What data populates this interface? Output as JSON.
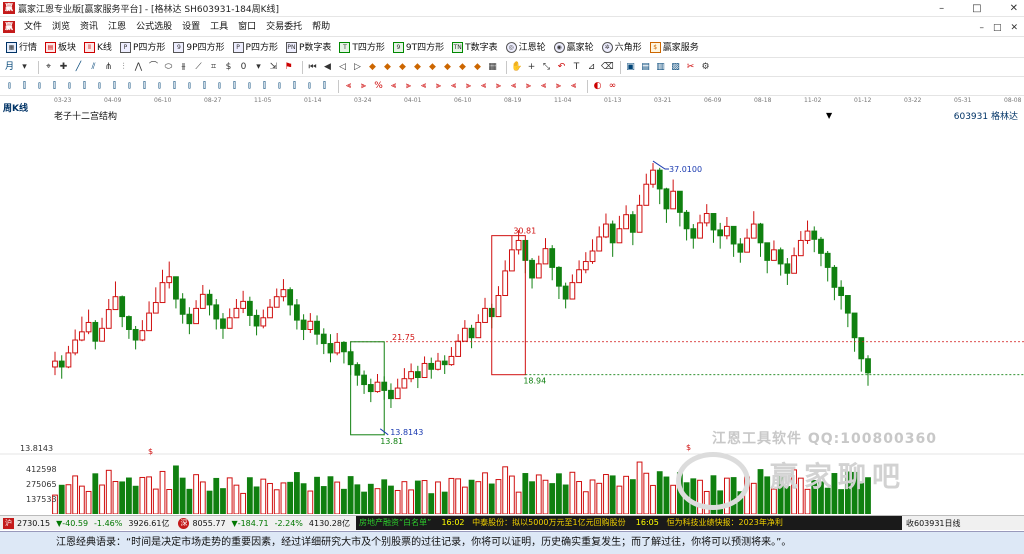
{
  "window": {
    "title": "赢家江恩专业版[赢家服务平台] - [格林达  SH603931-184周K线]",
    "minimize": "–",
    "restore": "□",
    "close": "✕"
  },
  "menu": {
    "items": [
      "文件",
      "浏览",
      "资讯",
      "江恩",
      "公式选股",
      "设置",
      "工具",
      "窗口",
      "交易委托",
      "帮助"
    ],
    "mdi": [
      "–",
      "□",
      "✕"
    ]
  },
  "toolbar1": {
    "items": [
      {
        "label": "行情",
        "icon": "grid-icon"
      },
      {
        "label": "板块",
        "icon": "blocks-icon"
      },
      {
        "label": "K线",
        "icon": "kline-icon"
      },
      {
        "label": "P四方形",
        "icon": "p-square-icon"
      },
      {
        "label": "9P四方形",
        "icon": "9p-square-icon"
      },
      {
        "label": "P四方形",
        "icon": "p-square-icon"
      },
      {
        "label": "P数字表",
        "icon": "p-table-icon"
      },
      {
        "label": "T四方形",
        "icon": "t-square-icon"
      },
      {
        "label": "9T四方形",
        "icon": "9t-square-icon"
      },
      {
        "label": "T数字表",
        "icon": "t-table-icon"
      },
      {
        "label": "江恩轮",
        "icon": "gann-wheel-icon"
      },
      {
        "label": "赢家轮",
        "icon": "winner-wheel-icon"
      },
      {
        "label": "六角形",
        "icon": "hexagon-icon"
      },
      {
        "label": "赢家服务",
        "icon": "dollar-icon"
      }
    ]
  },
  "toolbar2": {
    "period_select": "月"
  },
  "chart_header": {
    "period": "周K线",
    "study_name": "老子十二宫结构",
    "stock_code": "603931",
    "stock_name": "格林达",
    "dropdown": "▼"
  },
  "date_ticks": [
    "03-23",
    "04-09",
    "06-10",
    "08-27",
    "11-05",
    "01-14",
    "03-24",
    "04-01",
    "06-10",
    "08-19",
    "11-04",
    "01-13",
    "03-21",
    "06-09",
    "08-18",
    "11-02",
    "01-12",
    "03-22",
    "05-31",
    "08-08"
  ],
  "chart_data": {
    "type": "candlestick",
    "annotations": [
      {
        "text": "37.0100",
        "value": 37.01
      },
      {
        "text": "30.81",
        "value": 30.81
      },
      {
        "text": "21.75",
        "value": 21.75
      },
      {
        "text": "18.94",
        "value": 18.94
      },
      {
        "text": "13.81",
        "value": 13.81
      },
      {
        "text": "13.8143",
        "value": 13.8143
      },
      {
        "text": "$",
        "value": null
      },
      {
        "text": "$",
        "value": null
      }
    ],
    "price_level_label": "13.8143",
    "volume_axis_ticks": [
      "412598",
      "275065",
      "137533"
    ],
    "ohlc_close": [
      20.1,
      19.6,
      20.8,
      21.9,
      22.6,
      23.4,
      21.8,
      22.9,
      24.5,
      25.6,
      23.9,
      22.8,
      21.9,
      22.7,
      24.2,
      25.1,
      26.8,
      27.3,
      25.4,
      24.1,
      23.3,
      24.6,
      25.8,
      24.9,
      23.7,
      22.9,
      23.8,
      24.6,
      25.2,
      24.0,
      23.1,
      23.8,
      24.7,
      25.6,
      26.2,
      24.9,
      23.6,
      22.8,
      23.5,
      22.4,
      21.6,
      20.8,
      21.7,
      20.9,
      19.8,
      18.9,
      18.1,
      17.5,
      18.3,
      17.6,
      16.9,
      17.8,
      18.6,
      19.2,
      18.7,
      19.9,
      19.4,
      20.1,
      19.8,
      20.5,
      21.8,
      22.9,
      22.1,
      23.4,
      24.6,
      23.9,
      25.7,
      27.8,
      29.6,
      30.4,
      28.7,
      27.2,
      28.4,
      29.7,
      28.1,
      26.5,
      25.4,
      26.8,
      27.9,
      28.6,
      29.5,
      30.7,
      31.8,
      30.2,
      31.4,
      32.6,
      31.1,
      33.4,
      35.2,
      36.4,
      34.8,
      33.1,
      34.6,
      32.8,
      31.4,
      30.6,
      31.9,
      32.7,
      31.3,
      30.8,
      31.6,
      30.1,
      29.4,
      30.6,
      31.8,
      30.2,
      28.7,
      29.6,
      28.4,
      27.6,
      29.1,
      30.4,
      31.2,
      30.5,
      29.3,
      28.1,
      26.4,
      25.7,
      24.2,
      22.1,
      20.3,
      19.1
    ],
    "ohlc_high": [
      20.9,
      20.6,
      21.4,
      22.8,
      23.9,
      24.5,
      23.6,
      23.8,
      25.4,
      26.9,
      25.7,
      24.0,
      23.1,
      23.6,
      25.2,
      26.4,
      27.9,
      28.6,
      27.3,
      25.9,
      24.7,
      25.3,
      26.6,
      26.2,
      25.4,
      24.2,
      24.6,
      25.4,
      26.1,
      25.6,
      24.5,
      24.5,
      25.4,
      26.3,
      27.1,
      26.4,
      25.4,
      24.1,
      24.2,
      24.0,
      22.9,
      22.4,
      22.5,
      21.8,
      21.1,
      20.0,
      19.3,
      18.6,
      19.0,
      18.8,
      18.2,
      18.6,
      19.5,
      19.9,
      19.7,
      20.5,
      20.4,
      20.8,
      20.6,
      21.3,
      22.4,
      23.6,
      23.2,
      24.1,
      25.5,
      25.0,
      26.5,
      28.7,
      30.8,
      31.3,
      30.4,
      28.9,
      29.1,
      30.6,
      30.0,
      28.2,
      26.8,
      27.5,
      28.7,
      29.4,
      30.5,
      31.6,
      32.7,
      32.1,
      32.5,
      33.4,
      32.9,
      34.3,
      36.1,
      37.01,
      36.6,
      34.9,
      35.6,
      34.4,
      33.0,
      31.8,
      32.6,
      33.5,
      32.6,
      31.9,
      32.4,
      31.5,
      30.6,
      31.4,
      32.9,
      31.9,
      30.2,
      30.4,
      29.8,
      28.9,
      29.8,
      31.2,
      32.1,
      31.6,
      30.7,
      29.5,
      28.3,
      27.0,
      25.6,
      24.0,
      21.9,
      20.6
    ],
    "ohlc_low": [
      18.9,
      18.6,
      19.5,
      20.6,
      21.8,
      22.4,
      21.1,
      21.9,
      23.4,
      24.6,
      23.0,
      22.0,
      21.1,
      21.8,
      23.4,
      24.3,
      25.8,
      26.3,
      24.6,
      23.3,
      22.4,
      23.6,
      24.9,
      24.0,
      22.8,
      22.0,
      22.9,
      23.8,
      24.2,
      23.1,
      22.3,
      22.9,
      23.9,
      24.8,
      25.2,
      24.0,
      22.8,
      21.9,
      22.5,
      21.5,
      20.7,
      20.0,
      20.6,
      19.9,
      18.9,
      18.0,
      17.3,
      16.6,
      17.4,
      16.8,
      16.1,
      16.9,
      17.8,
      18.3,
      17.8,
      18.9,
      18.6,
      19.3,
      19.0,
      19.7,
      20.9,
      21.9,
      21.2,
      22.4,
      23.6,
      22.9,
      24.6,
      26.6,
      28.4,
      29.2,
      27.6,
      26.3,
      27.4,
      28.6,
      27.0,
      25.4,
      24.6,
      25.8,
      26.8,
      27.6,
      28.4,
      29.6,
      30.6,
      29.0,
      30.4,
      31.4,
      30.0,
      32.1,
      33.9,
      34.9,
      33.5,
      31.9,
      33.4,
      31.6,
      30.4,
      29.7,
      30.8,
      31.6,
      30.2,
      29.7,
      30.5,
      29.0,
      28.5,
      29.6,
      30.6,
      29.0,
      27.6,
      28.7,
      27.4,
      26.6,
      28.1,
      29.3,
      30.1,
      29.4,
      28.2,
      26.9,
      25.3,
      24.5,
      23.0,
      20.9,
      19.2,
      18.0
    ],
    "price_range": [
      12,
      40
    ]
  },
  "status": {
    "index1": {
      "value": "2730.15",
      "change": "▼-40.59",
      "pct": "-1.46%",
      "amount": "3926.61亿"
    },
    "index2": {
      "value": "8055.77",
      "change": "▼-184.71",
      "pct": "-2.24%",
      "amount": "4130.28亿"
    },
    "ticker_segments": [
      {
        "text": "房地产融资“白名单”",
        "color": "green"
      },
      {
        "text": "16:02",
        "color": "yellow"
      },
      {
        "text": "中泰股份：拟以5000万元至1亿元回购股份",
        "color": "gold"
      },
      {
        "text": "16:05",
        "color": "yellow"
      },
      {
        "text": "恒为科技业绩快报：2023年净利",
        "color": "gold"
      }
    ],
    "right_label": "收603931日线"
  },
  "watermark": {
    "line1": "江恩工具软件  QQ:100800360",
    "line2": "赢家聊吧"
  },
  "quote_bar": "江恩经典语录：“时间是决定市场走势的重要因素，经过详细研究大市及个别股票的过往记录，你将可以证明，历史确实重复发生；而了解过往，你将可以预测将来。”。"
}
